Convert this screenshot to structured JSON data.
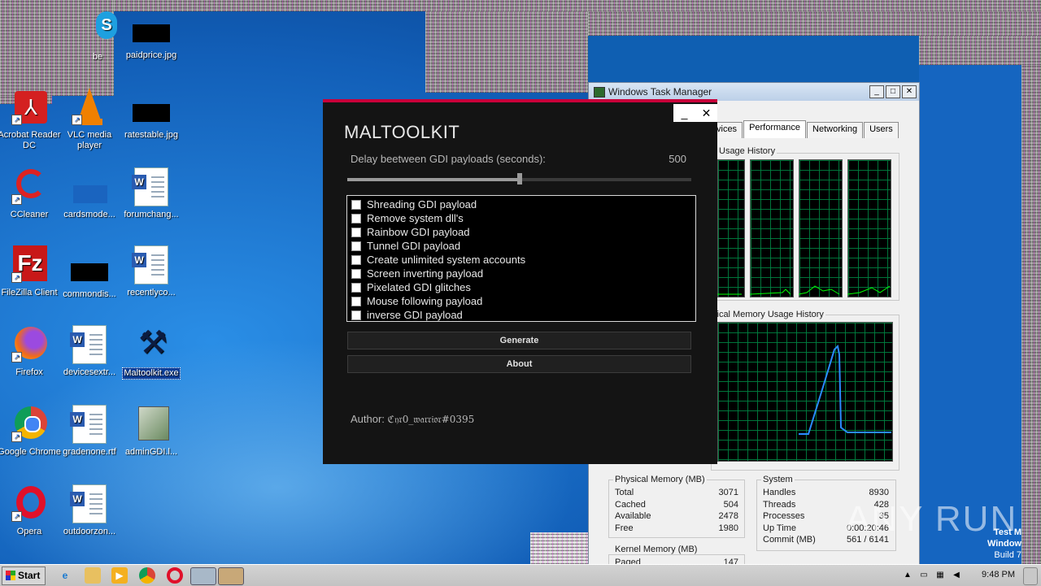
{
  "desktop": {
    "icons": [
      {
        "label": "be",
        "icon": "skype-icon"
      },
      {
        "label": "paidprice.jpg",
        "icon": "image-file-icon"
      },
      {
        "label": "Acrobat Reader DC",
        "icon": "acrobat-icon"
      },
      {
        "label": "VLC media player",
        "icon": "vlc-icon"
      },
      {
        "label": "ratestable.jpg",
        "icon": "image-file-icon"
      },
      {
        "label": "CCleaner",
        "icon": "ccleaner-icon"
      },
      {
        "label": "cardsmode...",
        "icon": "blank-file-icon"
      },
      {
        "label": "forumchang...",
        "icon": "word-doc-icon"
      },
      {
        "label": "FileZilla Client",
        "icon": "filezilla-icon"
      },
      {
        "label": "commondis...",
        "icon": "image-file-icon"
      },
      {
        "label": "recentlyco...",
        "icon": "word-doc-icon"
      },
      {
        "label": "Firefox",
        "icon": "firefox-icon"
      },
      {
        "label": "devicesextr...",
        "icon": "word-doc-icon"
      },
      {
        "label": "Maltoolkit.exe",
        "icon": "tools-icon"
      },
      {
        "label": "Google Chrome",
        "icon": "chrome-icon"
      },
      {
        "label": "gradenone.rtf",
        "icon": "word-doc-icon"
      },
      {
        "label": "adminGDI.l...",
        "icon": "installer-icon"
      },
      {
        "label": "Opera",
        "icon": "opera-icon"
      },
      {
        "label": "outdoorzon...",
        "icon": "word-doc-icon"
      }
    ]
  },
  "maltoolkit": {
    "title": "MALTOOLKIT",
    "minimize": "_",
    "close": "✕",
    "delay_label": "Delay beetween GDI payloads (seconds):",
    "delay_value": "500",
    "slider_fraction": 0.5,
    "payloads": [
      "Shreading GDI payload",
      "Remove system dll's",
      "Rainbow GDI payload",
      "Tunnel GDI payload",
      "Create unlimited system accounts",
      "Screen inverting payload",
      "Pixelated GDI glitches",
      "Mouse following payload",
      "inverse GDI payload"
    ],
    "generate_label": "Generate",
    "about_label": "About",
    "author_label": "Author:",
    "author_name": "ℭ𝔶𝔯0_𝔴𝔞𝔯𝔯𝔦𝔬𝔯#0395"
  },
  "taskmgr": {
    "title": "Windows Task Manager",
    "tabs": [
      "vices",
      "Performance",
      "Networking",
      "Users"
    ],
    "cpu_history_label": "Usage History",
    "mem_history_label": "sical Memory Usage History",
    "physical_memory": {
      "header": "Physical Memory (MB)",
      "rows": [
        {
          "k": "Total",
          "v": "3071"
        },
        {
          "k": "Cached",
          "v": "504"
        },
        {
          "k": "Available",
          "v": "2478"
        },
        {
          "k": "Free",
          "v": "1980"
        }
      ]
    },
    "kernel_memory": {
      "header": "Kernel Memory (MB)",
      "paged_label": "Paged",
      "paged_value": "147"
    },
    "system": {
      "header": "System",
      "rows": [
        {
          "k": "Handles",
          "v": "8930"
        },
        {
          "k": "Threads",
          "v": "428"
        },
        {
          "k": "Processes",
          "v": "35"
        },
        {
          "k": "Up Time",
          "v": "0:00:20:46"
        },
        {
          "k": "Commit (MB)",
          "v": "561 / 6141"
        }
      ]
    }
  },
  "taskbar": {
    "start_label": "Start",
    "clock": "9:48 PM",
    "watermark_text": "ANY RUN",
    "test_mode_line1": "Test M",
    "test_mode_line2": "Window",
    "test_mode_line3": "Build 7"
  }
}
